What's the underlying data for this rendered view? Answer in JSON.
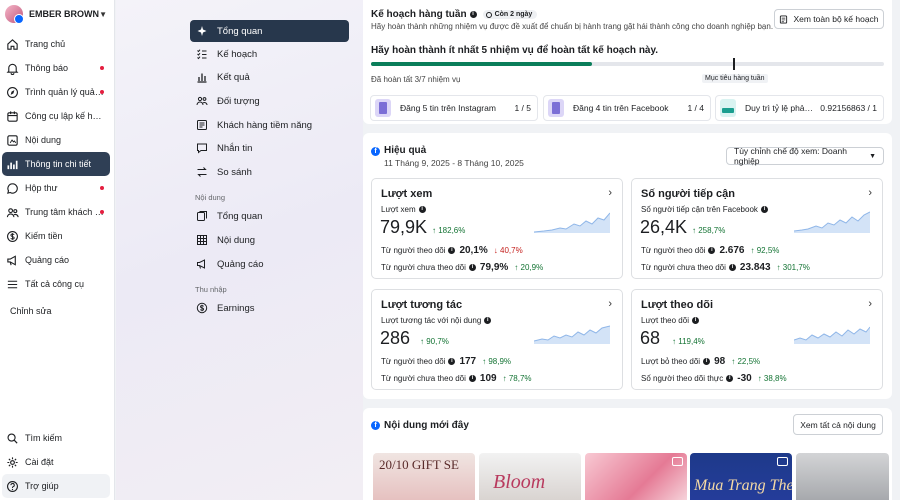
{
  "profile": {
    "name": "EMBER BROWN"
  },
  "sidebar": {
    "items": [
      {
        "label": "Trang chủ",
        "icon": "home-icon"
      },
      {
        "label": "Thông báo",
        "icon": "bell-icon",
        "dot": true
      },
      {
        "label": "Trình quản lý quảng ...",
        "icon": "compass-icon",
        "dot": true
      },
      {
        "label": "Công cụ lập kế hoạch",
        "icon": "calendar-icon"
      },
      {
        "label": "Nội dung",
        "icon": "content-icon"
      },
      {
        "label": "Thông tin chi tiết",
        "icon": "insights-icon",
        "active": true
      },
      {
        "label": "Hộp thư",
        "icon": "chat-icon",
        "dot": true
      },
      {
        "label": "Trung tâm khách h...",
        "icon": "people-icon",
        "dot": true
      },
      {
        "label": "Kiếm tiền",
        "icon": "dollar-icon"
      },
      {
        "label": "Quảng cáo",
        "icon": "megaphone-icon"
      },
      {
        "label": "Tất cả công cụ",
        "icon": "menu-icon"
      }
    ],
    "edit_label": "Chỉnh sửa",
    "bottom": [
      {
        "label": "Tìm kiếm",
        "icon": "search-icon"
      },
      {
        "label": "Cài đặt",
        "icon": "gear-icon"
      },
      {
        "label": "Trợ giúp",
        "icon": "help-icon"
      }
    ]
  },
  "subnav": {
    "items": [
      {
        "label": "Tổng quan",
        "icon": "sparkle-icon",
        "active": true
      },
      {
        "label": "Kế hoạch",
        "icon": "checklist-icon"
      },
      {
        "label": "Kết quả",
        "icon": "bar-chart-icon"
      },
      {
        "label": "Đối tượng",
        "icon": "audience-icon"
      },
      {
        "label": "Khách hàng tiềm năng",
        "icon": "leads-icon"
      },
      {
        "label": "Nhắn tin",
        "icon": "message-icon"
      },
      {
        "label": "So sánh",
        "icon": "compare-icon"
      }
    ],
    "section_content": "Nội dung",
    "content_items": [
      {
        "label": "Tổng quan",
        "icon": "content-overview-icon"
      },
      {
        "label": "Nội dung",
        "icon": "grid-icon"
      },
      {
        "label": "Quảng cáo",
        "icon": "megaphone-icon"
      }
    ],
    "section_income": "Thu nhập",
    "income_items": [
      {
        "label": "Earnings",
        "icon": "earnings-icon"
      }
    ]
  },
  "plan": {
    "title": "Kế hoạch hàng tuần",
    "badge": "Còn 2 ngày",
    "description": "Hãy hoàn thành những nhiệm vụ được đề xuất để chuẩn bị hành trang gặt hái thành công cho doanh nghiệp bạn.",
    "view_button": "Xem toàn bộ kế hoạch",
    "goal": "Hãy hoàn thành ít nhất 5 nhiệm vụ để hoàn tất kế hoạch này.",
    "progress_fraction": 0.43,
    "progress_text": "Đã hoàn tất 3/7 nhiệm vụ",
    "weekly_goal_label": "Mục tiêu hàng tuần",
    "tasks": [
      {
        "label": "Đăng 5 tin trên Instagram",
        "count": "1 / 5"
      },
      {
        "label": "Đăng 4 tin trên Facebook",
        "count": "1 / 4"
      },
      {
        "label": "Duy trì tỷ lệ phản ...",
        "count": "0.92156863 / 1"
      }
    ]
  },
  "performance": {
    "title": "Hiệu quả",
    "date_range": "11 Tháng 9, 2025 - 8 Tháng 10, 2025",
    "view_select": "Tùy chỉnh chế độ xem: Doanh nghiệp",
    "metrics": [
      {
        "title": "Lượt xem",
        "sub": "Lượt xem",
        "value": "79,9K",
        "delta": "182,6%",
        "delta_dir": "up",
        "rows": [
          {
            "label": "Từ người theo dõi",
            "value": "20,1%",
            "delta": "40,7%",
            "dir": "down"
          },
          {
            "label": "Từ người chưa theo dõi",
            "value": "79,9%",
            "delta": "20,9%",
            "dir": "up"
          }
        ]
      },
      {
        "title": "Số người tiếp cận",
        "sub": "Số người tiếp cận trên Facebook",
        "value": "26,4K",
        "delta": "258,7%",
        "delta_dir": "up",
        "rows": [
          {
            "label": "Từ người theo dõi",
            "value": "2.676",
            "delta": "92,5%",
            "dir": "up"
          },
          {
            "label": "Từ người chưa theo dõi",
            "value": "23.843",
            "delta": "301,7%",
            "dir": "up"
          }
        ]
      },
      {
        "title": "Lượt tương tác",
        "sub": "Lượt tương tác với nội dung",
        "value": "286",
        "delta": "90,7%",
        "delta_dir": "up",
        "rows": [
          {
            "label": "Từ người theo dõi",
            "value": "177",
            "delta": "98,9%",
            "dir": "up"
          },
          {
            "label": "Từ người chưa theo dõi",
            "value": "109",
            "delta": "78,7%",
            "dir": "up"
          }
        ]
      },
      {
        "title": "Lượt theo dõi",
        "sub": "Lượt theo dõi",
        "value": "68",
        "delta": "119,4%",
        "delta_dir": "up",
        "rows": [
          {
            "label": "Lượt bỏ theo dõi",
            "value": "98",
            "delta": "22,5%",
            "dir": "up"
          },
          {
            "label": "Số người theo dõi thực",
            "value": "-30",
            "delta": "38,8%",
            "dir": "up"
          }
        ]
      }
    ]
  },
  "recent": {
    "title": "Nội dung mới đây",
    "view_all": "Xem tất cả nội dung",
    "thumbs": [
      {
        "text": "20/10 GIFT SE"
      },
      {
        "text": "Bloom"
      },
      {
        "text": ""
      },
      {
        "text": "Mua Trang The"
      },
      {
        "text": ""
      }
    ]
  },
  "colors": {
    "accent": "#0866ff",
    "active_nav": "#2f3f55",
    "progress": "#0a7e5a",
    "up": "#137333",
    "down": "#c5221f",
    "notify_dot": "#e41e3f"
  }
}
